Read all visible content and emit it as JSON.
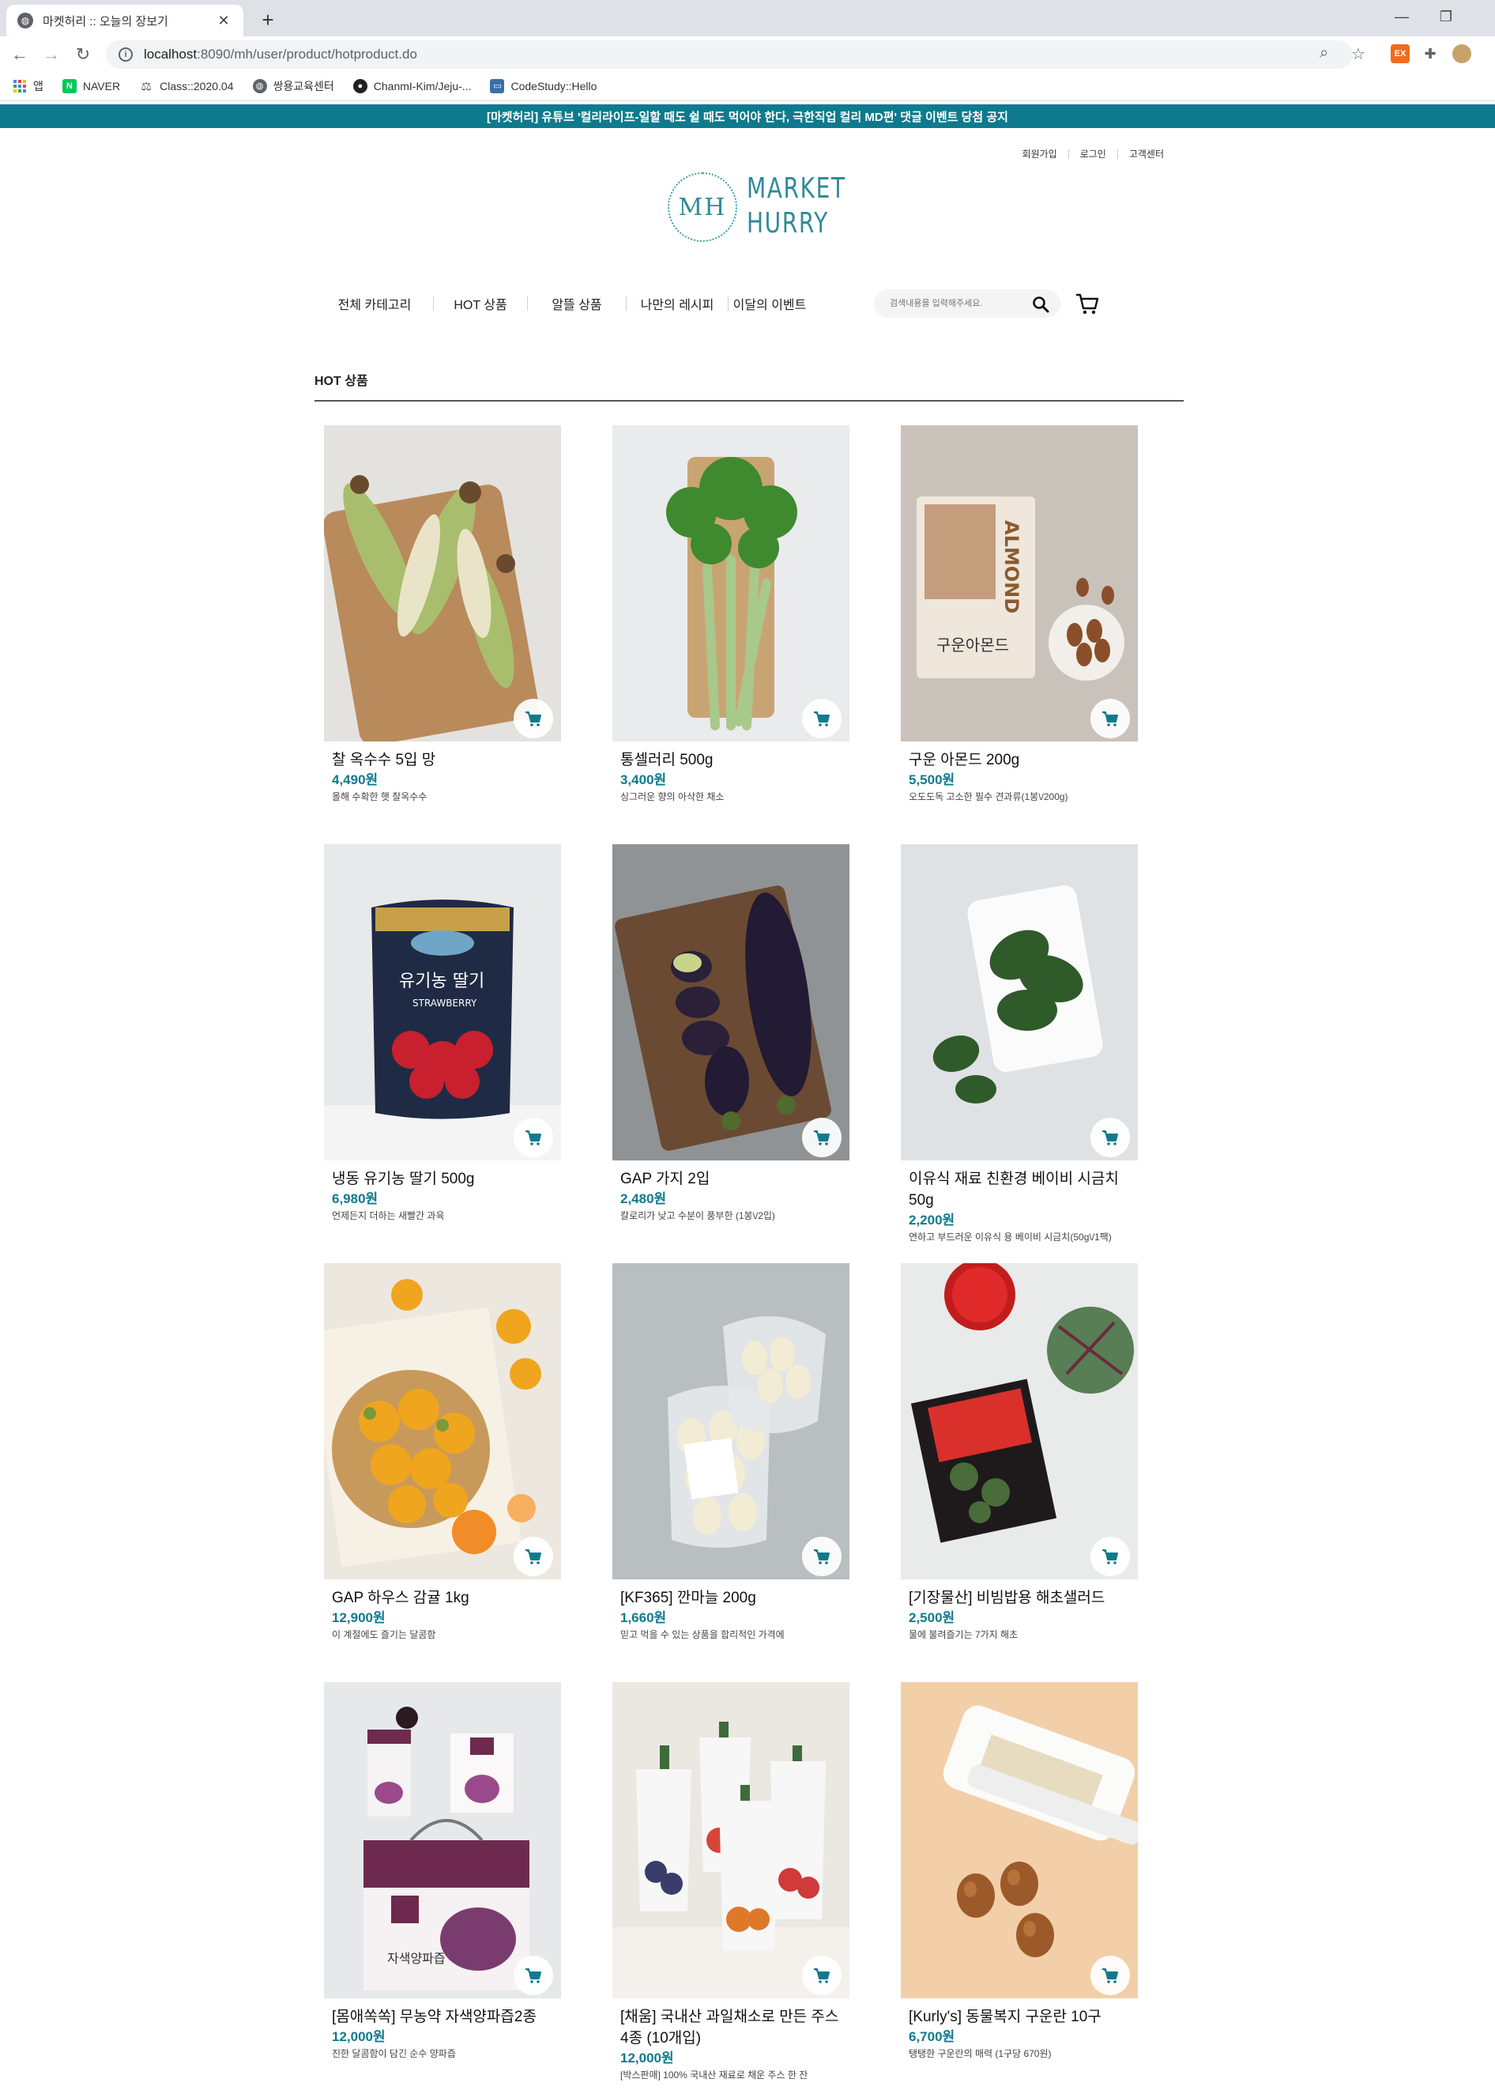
{
  "browser": {
    "tab_title": "마켓허리 :: 오늘의 장보기",
    "url_host": "localhost",
    "url_path": ":8090/mh/user/product/hotproduct.do",
    "bookmarks": [
      {
        "label": "앱",
        "icon": "apps-grid-icon",
        "color": "#4285f4"
      },
      {
        "label": "NAVER",
        "icon": "naver-icon",
        "color": "#03c75a"
      },
      {
        "label": "Class::2020.04",
        "icon": "scale-icon",
        "color": "#555555"
      },
      {
        "label": "쌍용교육센터",
        "icon": "globe-icon",
        "color": "#5f6368"
      },
      {
        "label": "ChanmI-Kim/Jeju-...",
        "icon": "github-icon",
        "color": "#222222"
      },
      {
        "label": "CodeStudy::Hello",
        "icon": "monitor-icon",
        "color": "#3a6ea5"
      }
    ]
  },
  "site": {
    "notice": "[마켓허리] 유튜브 '컬리라이프-일할 때도 쉴 때도 먹어야 한다, 극한직업 컬리 MD편' 댓글 이벤트 당첨 공지",
    "usermenu": {
      "signup": "회원가입",
      "login": "로그인",
      "support": "고객센터"
    },
    "logo": {
      "mark": "MH",
      "line1": "MARKET",
      "line2": "HURRY"
    },
    "nav": [
      "전체 카테고리",
      "HOT 상품",
      "알뜰 상품",
      "나만의 레시피",
      "이달의 이벤트"
    ],
    "search_placeholder": "검색내용을 입력해주세요.",
    "section_title": "HOT 상품",
    "accent": "#0f7a8d"
  },
  "products": [
    {
      "name": "찰 옥수수 5입 망",
      "price": "4,490원",
      "desc": "올해 수확한 햇 찰옥수수"
    },
    {
      "name": "통셀러리 500g",
      "price": "3,400원",
      "desc": "싱그러운 향의 아삭한 채소"
    },
    {
      "name": "구운 아몬드 200g",
      "price": "5,500원",
      "desc": "오도도독 고소한 필수 견과류(1봉\\/200g)"
    },
    {
      "name": "냉동 유기농 딸기 500g",
      "price": "6,980원",
      "desc": "언제든지 더하는 새빨간 과육"
    },
    {
      "name": "GAP 가지 2입",
      "price": "2,480원",
      "desc": "칼로리가 낮고 수분이 풍부한 (1봉\\/2입)"
    },
    {
      "name": "이유식 재료 친환경 베이비 시금치 50g",
      "price": "2,200원",
      "desc": "연하고 부드러운 이유식 용 베이비 시금치(50g\\/1팩)"
    },
    {
      "name": "GAP 하우스 감귤 1kg",
      "price": "12,900원",
      "desc": "이 계절에도 즐기는 달콤함"
    },
    {
      "name": "[KF365] 깐마늘 200g",
      "price": "1,660원",
      "desc": "믿고 먹을 수 있는 상품을 합리적인 가격에"
    },
    {
      "name": "[기장물산] 비빔밥용 해초샐러드",
      "price": "2,500원",
      "desc": "물에 불려즐기는 7가지 해초"
    },
    {
      "name": "[몸애쏙쏙] 무농약 자색양파즙2종",
      "price": "12,000원",
      "desc": "진한 달콤함이 담긴 순수 양파즙"
    },
    {
      "name": "[채움] 국내산 과일채소로 만든 주스 4종 (10개입)",
      "price": "12,000원",
      "desc": "[박스판매] 100% 국내산 재료로 채운 주스 한 잔"
    },
    {
      "name": "[Kurly's] 동물복지 구운란 10구",
      "price": "6,700원",
      "desc": "탱탱한 구운란의 매력 (1구당 670원)"
    }
  ]
}
